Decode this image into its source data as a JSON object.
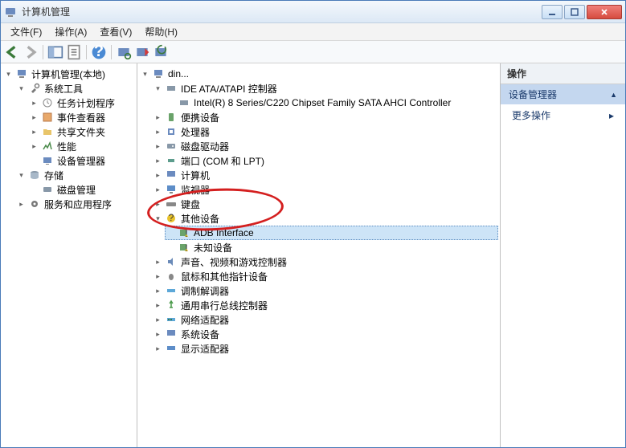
{
  "window": {
    "title": "计算机管理"
  },
  "menu": {
    "file": "文件(F)",
    "action": "操作(A)",
    "view": "查看(V)",
    "help": "帮助(H)"
  },
  "left_tree": {
    "root": "计算机管理(本地)",
    "system_tools": "系统工具",
    "task_scheduler": "任务计划程序",
    "event_viewer": "事件查看器",
    "shared_folders": "共享文件夹",
    "performance": "性能",
    "device_manager": "设备管理器",
    "storage": "存储",
    "disk_management": "磁盘管理",
    "services_apps": "服务和应用程序"
  },
  "device_tree": {
    "root": "din...",
    "ide": "IDE ATA/ATAPI 控制器",
    "intel_sata": "Intel(R) 8 Series/C220 Chipset Family SATA AHCI Controller",
    "portable": "便携设备",
    "processors": "处理器",
    "disk_drives": "磁盘驱动器",
    "ports": "端口 (COM 和 LPT)",
    "computer": "计算机",
    "monitors": "监视器",
    "keyboards": "键盘",
    "other_devices": "其他设备",
    "adb_interface": "ADB Interface",
    "unknown_device": "未知设备",
    "sound_video": "声音、视频和游戏控制器",
    "mice": "鼠标和其他指针设备",
    "modems": "调制解调器",
    "usb": "通用串行总线控制器",
    "network": "网络适配器",
    "system_devices": "系统设备",
    "display": "显示适配器"
  },
  "actions": {
    "header": "操作",
    "section": "设备管理器",
    "more": "更多操作"
  }
}
